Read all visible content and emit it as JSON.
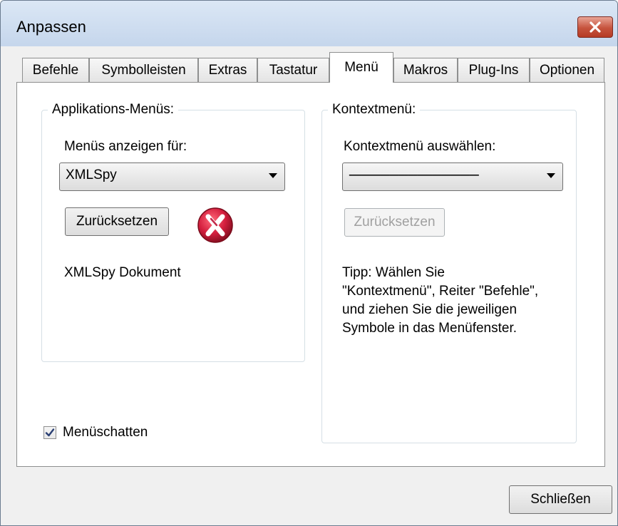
{
  "window": {
    "title": "Anpassen"
  },
  "tabs": [
    {
      "label": "Befehle"
    },
    {
      "label": "Symbolleisten"
    },
    {
      "label": "Extras"
    },
    {
      "label": "Tastatur"
    },
    {
      "label": "Menü",
      "active": true
    },
    {
      "label": "Makros"
    },
    {
      "label": "Plug-Ins"
    },
    {
      "label": "Optionen"
    }
  ],
  "app_menus": {
    "group_label": "Applikations-Menüs:",
    "show_for_label": "Menüs anzeigen für:",
    "show_for_value": "XMLSpy",
    "reset_label": "Zurücksetzen",
    "document_label": "XMLSpy Dokument"
  },
  "context_menu": {
    "group_label": "Kontextmenü:",
    "select_label": "Kontextmenü auswählen:",
    "select_value": "------------------------------------------",
    "reset_label": "Zurücksetzen",
    "tip_lines": [
      "Tipp: Wählen Sie",
      "\"Kontextmenü\", Reiter \"Befehle\",",
      "und ziehen Sie die jeweiligen",
      "Symbole in das Menüfenster."
    ]
  },
  "menu_shadow": {
    "label": "Menüschatten",
    "checked": true
  },
  "close_label": "Schließen",
  "icons": {
    "close": "close-x-icon",
    "check": "checkmark-icon",
    "dropdown": "chevron-down-icon",
    "menu_close": "red-circle-close-icon"
  },
  "colors": {
    "close_button": "#c6533d",
    "menu_close_icon": "#d41f3e"
  }
}
